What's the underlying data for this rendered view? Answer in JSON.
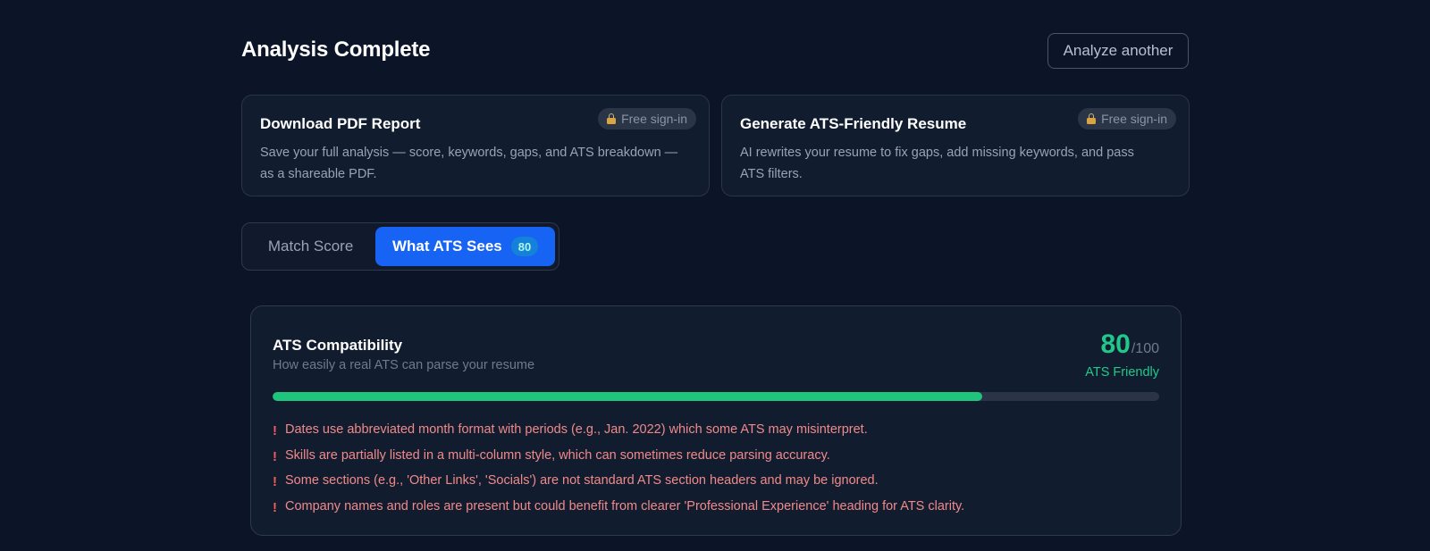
{
  "header": {
    "title": "Analysis Complete",
    "analyze_label": "Analyze another"
  },
  "cards": [
    {
      "title": "Download PDF Report",
      "badge": "Free sign-in",
      "description": "Save your full analysis — score, keywords, gaps, and ATS breakdown — as a shareable PDF."
    },
    {
      "title": "Generate ATS-Friendly Resume",
      "badge": "Free sign-in",
      "description": "AI rewrites your resume to fix gaps, add missing keywords, and pass ATS filters."
    }
  ],
  "tabs": [
    {
      "label": "Match Score",
      "active": false
    },
    {
      "label": "What ATS Sees",
      "active": true,
      "badge": "80"
    }
  ],
  "panel": {
    "title": "ATS Compatibility",
    "subtitle": "How easily a real ATS can parse your resume",
    "score": "80",
    "score_max": "/100",
    "score_label": "ATS Friendly",
    "progress_fraction": 0.8,
    "issue_marker": "!",
    "issues": [
      "Dates use abbreviated month format with periods (e.g., Jan. 2022) which some ATS may misinterpret.",
      "Skills are partially listed in a multi-column style, which can sometimes reduce parsing accuracy.",
      "Some sections (e.g., 'Other Links', 'Socials') are not standard ATS section headers and may be ignored.",
      "Company names and roles are present but could benefit from clearer 'Professional Experience' heading for ATS clarity."
    ]
  },
  "colors": {
    "background": "#0c1527",
    "accent_blue": "#1764f4",
    "success_green": "#20c98a",
    "warning_red": "#f08a8a"
  },
  "icons": {
    "badge_icon": "lock-icon",
    "issue_icon": "exclamation-icon"
  }
}
